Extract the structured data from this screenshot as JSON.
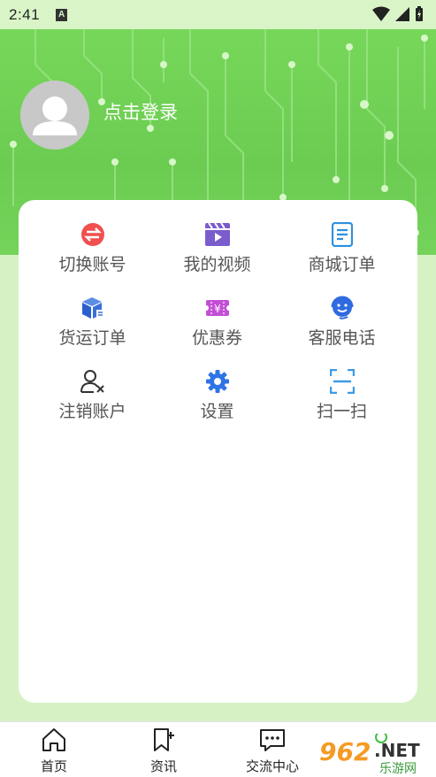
{
  "status_bar": {
    "time": "2:41",
    "notification_badge": "A"
  },
  "profile": {
    "login_text": "点击登录"
  },
  "menu": {
    "items": [
      {
        "label": "切换账号",
        "icon": "switch-account-icon",
        "color": "#f0504f"
      },
      {
        "label": "我的视频",
        "icon": "video-icon",
        "color": "#7b5ccc"
      },
      {
        "label": "商城订单",
        "icon": "order-list-icon",
        "color": "#2e8fe0"
      },
      {
        "label": "货运订单",
        "icon": "package-icon",
        "color": "#3b6fd9"
      },
      {
        "label": "优惠券",
        "icon": "coupon-icon",
        "color": "#c34fd6"
      },
      {
        "label": "客服电话",
        "icon": "customer-service-icon",
        "color": "#2f6ae0"
      },
      {
        "label": "注销账户",
        "icon": "remove-user-icon",
        "color": "#333333"
      },
      {
        "label": "设置",
        "icon": "gear-icon",
        "color": "#2e74e6"
      },
      {
        "label": "扫一扫",
        "icon": "scan-icon",
        "color": "#3d9be6"
      }
    ]
  },
  "tabbar": {
    "tabs": [
      {
        "label": "首页",
        "icon": "home-icon"
      },
      {
        "label": "资讯",
        "icon": "bookmark-add-icon"
      },
      {
        "label": "交流中心",
        "icon": "chat-icon"
      }
    ]
  },
  "watermark": {
    "brand": "962",
    "suffix": ".NET",
    "sub": "乐游网"
  },
  "colors": {
    "header_green": "#6ccc52",
    "page_bg": "#d6f2c4",
    "card_bg": "#ffffff"
  }
}
